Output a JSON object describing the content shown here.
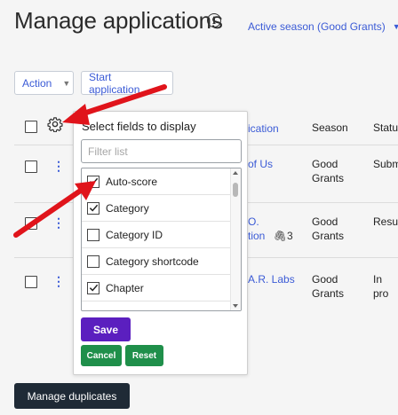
{
  "page": {
    "title": "Manage applications",
    "info_icon": "info-icon",
    "season_select": "Active season (Good Grants)"
  },
  "toolbar": {
    "action_label": "Action",
    "start_label": "Start application"
  },
  "table": {
    "headers": {
      "application_fragment": "ication",
      "season": "Season",
      "status_fragment": "Status"
    },
    "rows": [
      {
        "title": "of Us",
        "season_line1": "Good",
        "season_line2": "Grants",
        "status": "Subm"
      },
      {
        "title_line1": "O.",
        "title_line2": "tion",
        "attachments": "3",
        "season_line1": "Good",
        "season_line2": "Grants",
        "status": "Resul"
      },
      {
        "title": "A.R. Labs",
        "season_line1": "Good",
        "season_line2": "Grants",
        "status": "In pro"
      }
    ]
  },
  "popover": {
    "title": "Select fields to display",
    "filter_placeholder": "Filter list",
    "fields": [
      {
        "label": "Auto-score",
        "checked": true
      },
      {
        "label": "Category",
        "checked": true
      },
      {
        "label": "Category ID",
        "checked": false
      },
      {
        "label": "Category shortcode",
        "checked": false
      },
      {
        "label": "Chapter",
        "checked": true
      }
    ],
    "save_label": "Save",
    "cancel_label": "Cancel",
    "reset_label": "Reset"
  },
  "footer": {
    "manage_duplicates_label": "Manage duplicates"
  },
  "colors": {
    "link": "#3b5bd6",
    "save": "#5b1fbf",
    "green": "#1f8f4a",
    "dark_button": "#1f2a36",
    "annotation_arrow": "#e0141b"
  }
}
